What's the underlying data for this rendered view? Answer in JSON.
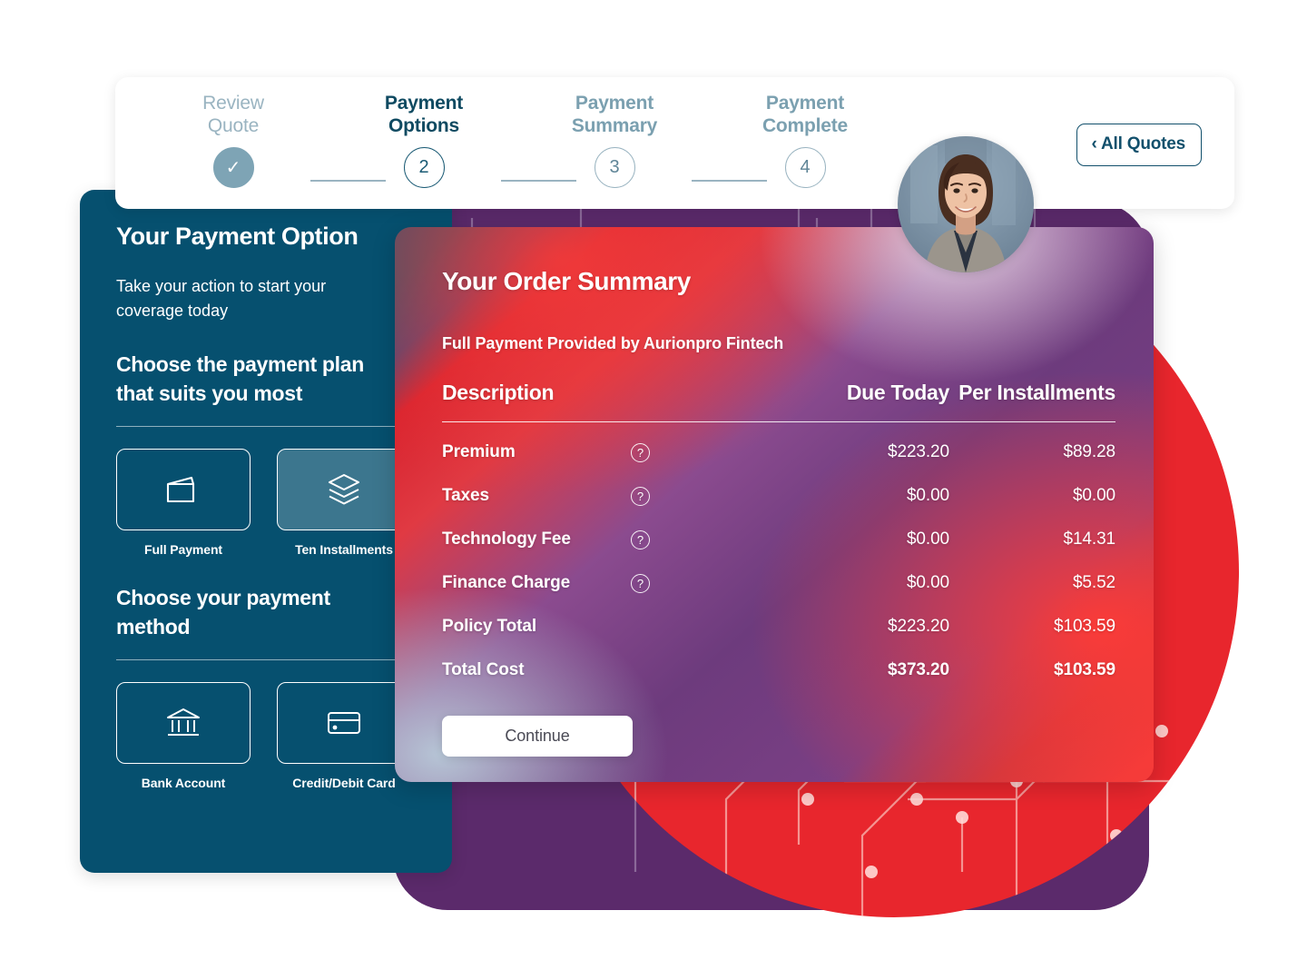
{
  "stepper": {
    "steps": [
      {
        "label_line1": "Review",
        "label_line2": "Quote",
        "marker": "✓",
        "state": "done"
      },
      {
        "label_line1": "Payment",
        "label_line2": "Options",
        "marker": "2",
        "state": "active"
      },
      {
        "label_line1": "Payment",
        "label_line2": "Summary",
        "marker": "3",
        "state": "upcoming"
      },
      {
        "label_line1": "Payment",
        "label_line2": "Complete",
        "marker": "4",
        "state": "upcoming"
      }
    ],
    "all_quotes_label": "‹ All Quotes"
  },
  "payment_option_panel": {
    "title": "Your Payment Option",
    "subtitle": "Take your action to start your coverage today",
    "plan_heading": "Choose the payment plan that suits you most",
    "plan_tiles": [
      {
        "label": "Full Payment",
        "icon": "wallet-icon",
        "selected": false
      },
      {
        "label": "Ten Installments",
        "icon": "layers-icon",
        "selected": true
      }
    ],
    "method_heading": "Choose your payment method",
    "method_tiles": [
      {
        "label": "Bank Account",
        "icon": "bank-icon",
        "selected": false
      },
      {
        "label": "Credit/Debit Card",
        "icon": "credit-card-icon",
        "selected": false
      }
    ]
  },
  "order_summary": {
    "title": "Your Order Summary",
    "provider_line": "Full Payment Provided by Aurionpro Fintech",
    "columns": [
      "Description",
      "",
      "Due Today",
      "Per Installments"
    ],
    "rows": [
      {
        "description": "Premium",
        "help": "?",
        "due_today": "$223.20",
        "per_installments": "$89.28",
        "emphasis": "normal"
      },
      {
        "description": "Taxes",
        "help": "?",
        "due_today": "$0.00",
        "per_installments": "$0.00",
        "emphasis": "normal"
      },
      {
        "description": "Technology Fee",
        "help": "?",
        "due_today": "$0.00",
        "per_installments": "$14.31",
        "emphasis": "normal"
      },
      {
        "description": "Finance Charge",
        "help": "?",
        "due_today": "$0.00",
        "per_installments": "$5.52",
        "emphasis": "normal"
      },
      {
        "description": "Policy Total",
        "help": "",
        "due_today": "$223.20",
        "per_installments": "$103.59",
        "emphasis": "subtotal"
      },
      {
        "description": "Total Cost",
        "help": "",
        "due_today": "$373.20",
        "per_installments": "$103.59",
        "emphasis": "total"
      }
    ],
    "continue_label": "Continue"
  },
  "colors": {
    "panel_blue": "#06506f",
    "accent_red": "#e8262d",
    "accent_purple": "#5b2a6b",
    "step_active": "#12506c",
    "step_muted": "#9ab4c1"
  }
}
